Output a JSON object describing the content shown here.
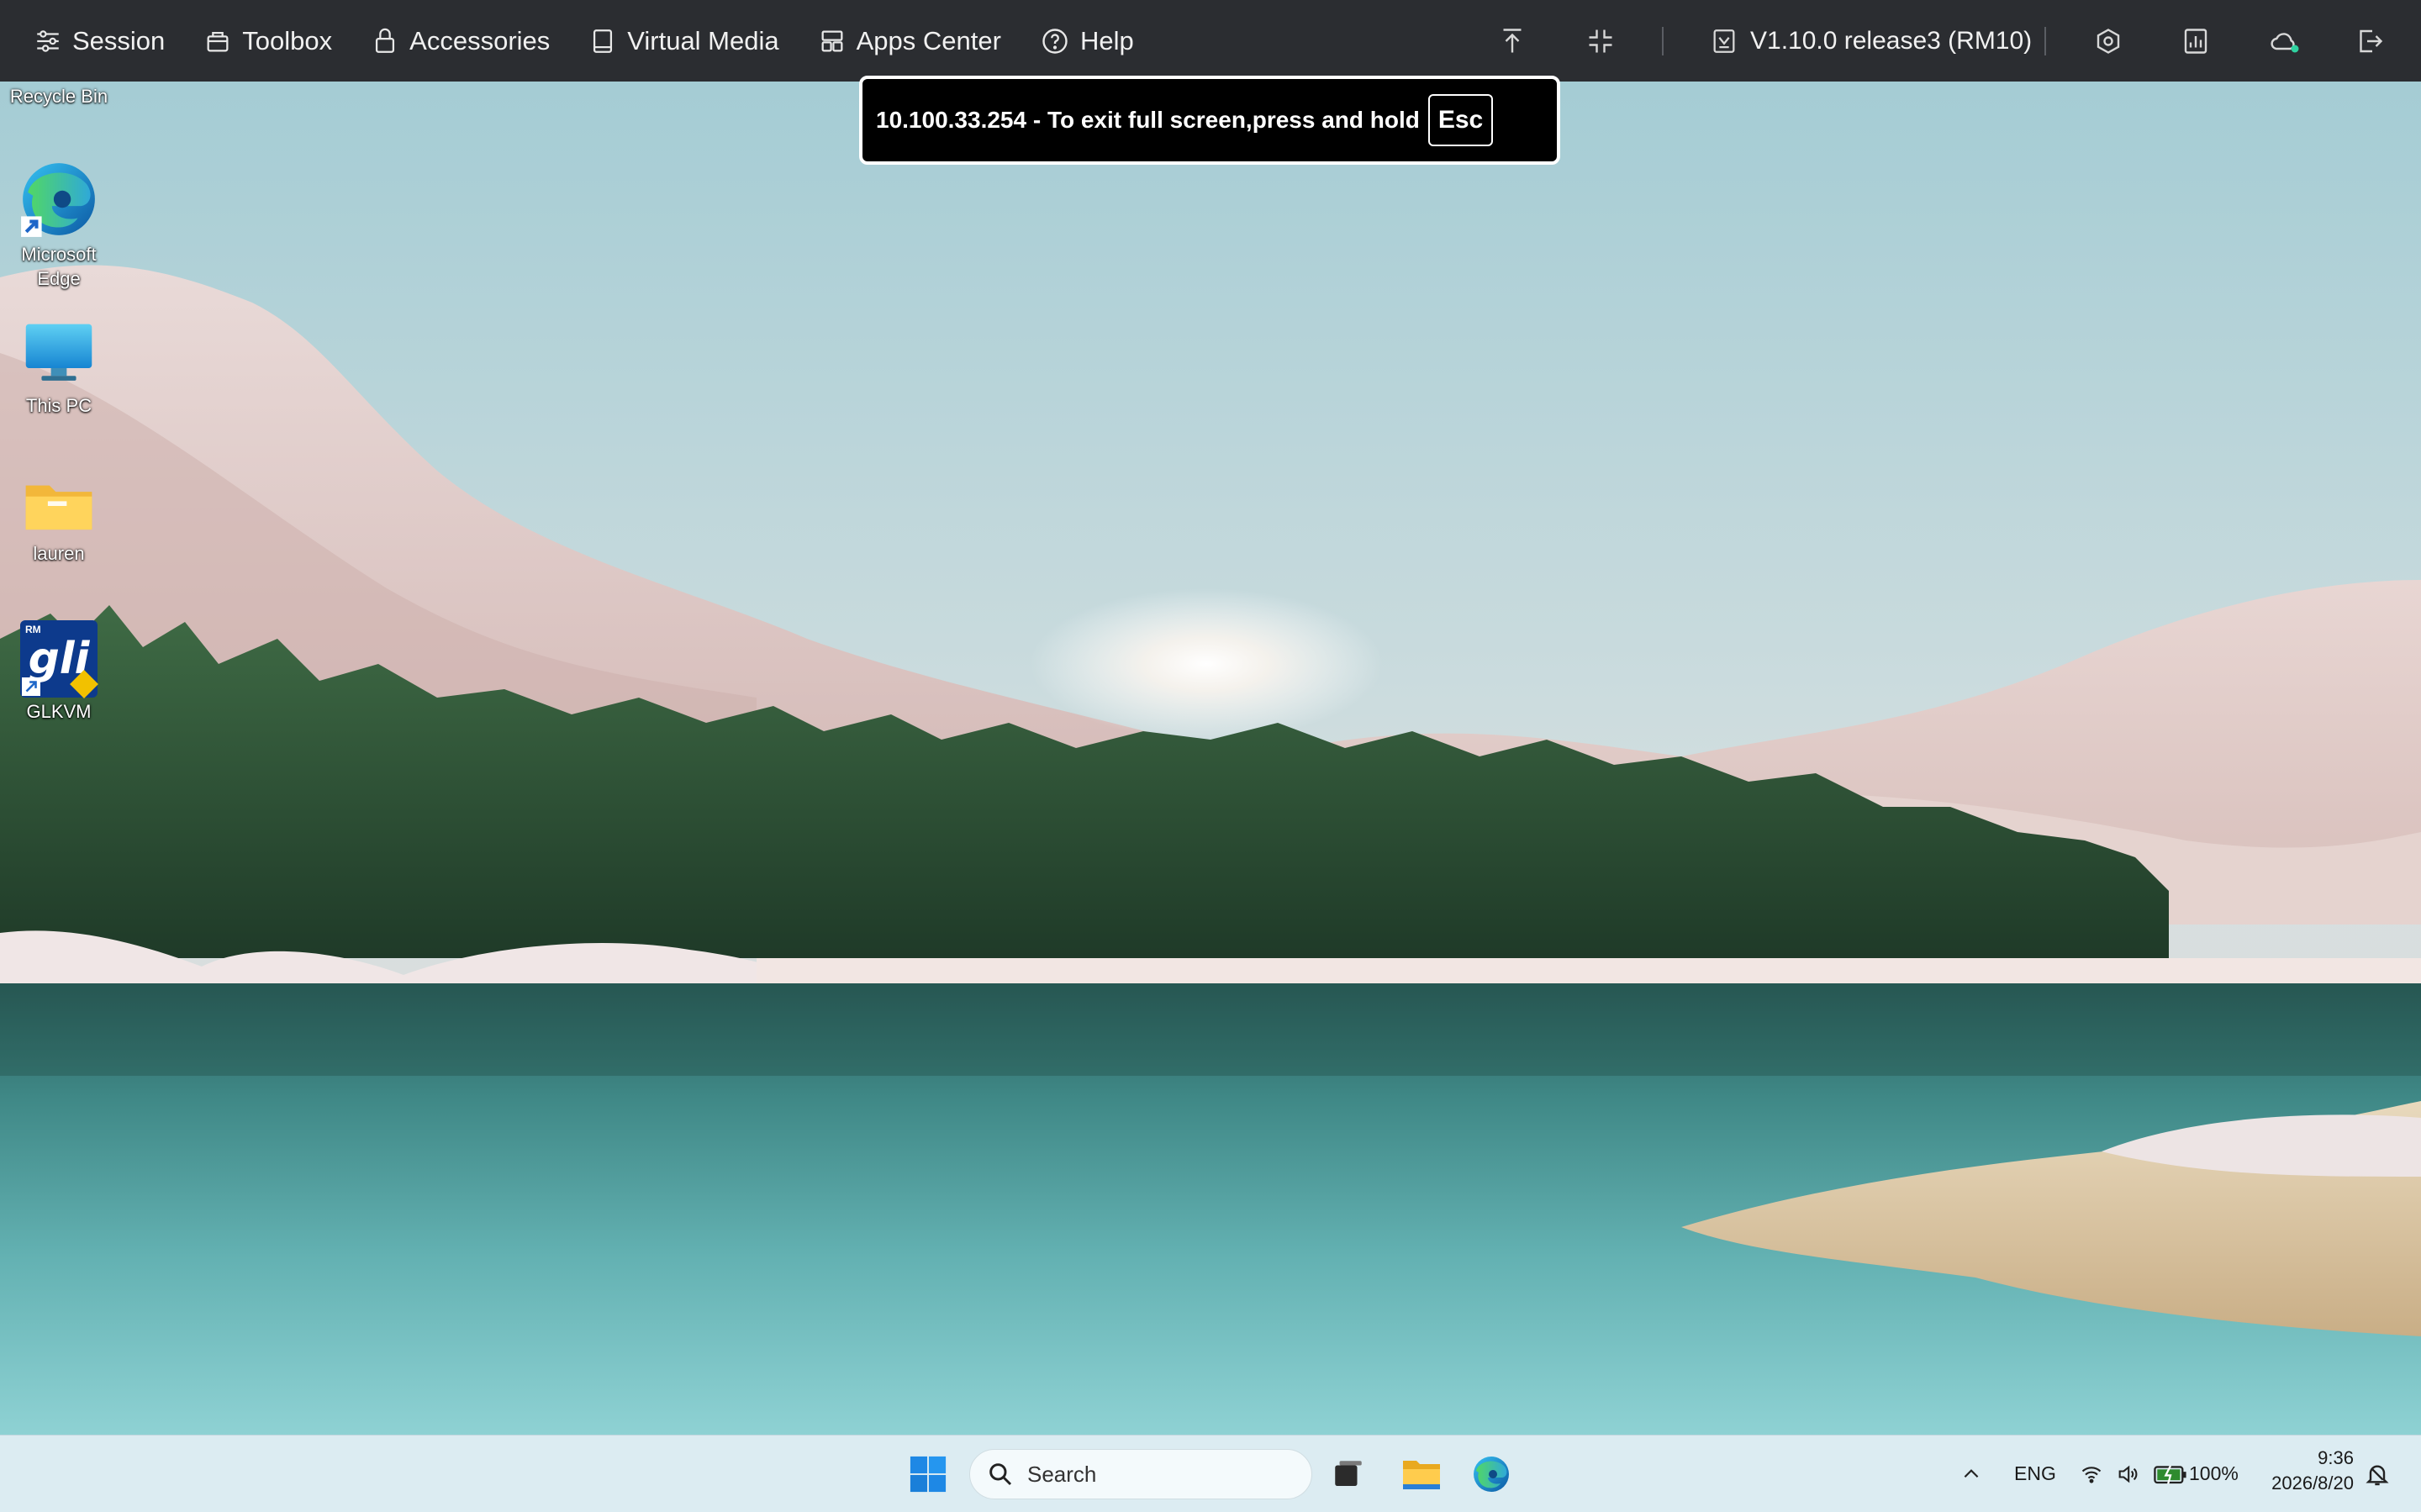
{
  "toolbar": {
    "menu": [
      {
        "label": "Session",
        "icon": "session-icon"
      },
      {
        "label": "Toolbox",
        "icon": "toolbox-icon"
      },
      {
        "label": "Accessories",
        "icon": "lock-icon"
      },
      {
        "label": "Virtual Media",
        "icon": "virtual-media-icon"
      },
      {
        "label": "Apps Center",
        "icon": "apps-grid-icon"
      },
      {
        "label": "Help",
        "icon": "help-icon"
      }
    ],
    "version_label": "V1.10.0 release3 (RM10)",
    "right_icons": [
      "pin-top-icon",
      "exit-fullscreen-icon",
      "target-icon",
      "performance-icon",
      "cloud-icon",
      "logout-icon"
    ],
    "colors": {
      "bar": "#2b2d31",
      "text": "#f1f1f1",
      "cloud_status": "#2fd2a0"
    }
  },
  "notice": {
    "text": "10.100.33.254 - To exit full screen,press and hold",
    "key": "Esc"
  },
  "desktop": {
    "icons": [
      {
        "label": "Recycle Bin",
        "icon": "recycle-bin-icon"
      },
      {
        "label": "Microsoft Edge",
        "icon": "edge-icon"
      },
      {
        "label": "This PC",
        "icon": "monitor-icon"
      },
      {
        "label": "lauren",
        "icon": "folder-icon"
      },
      {
        "label": "GLKVM",
        "icon": "glkvm-icon",
        "icon_text": "gli",
        "badge_text": "RM"
      }
    ]
  },
  "taskbar": {
    "search_placeholder": "Search",
    "apps": [
      "windows-start-icon",
      "search-icon",
      "task-view-icon",
      "file-explorer-icon",
      "edge-icon"
    ],
    "tray": {
      "language": "ENG",
      "battery": "100%",
      "time": "9:36",
      "date": "2026/8/20"
    },
    "colors": {
      "bar": "#dcecf2",
      "start_blue": "#1e88e5"
    }
  }
}
